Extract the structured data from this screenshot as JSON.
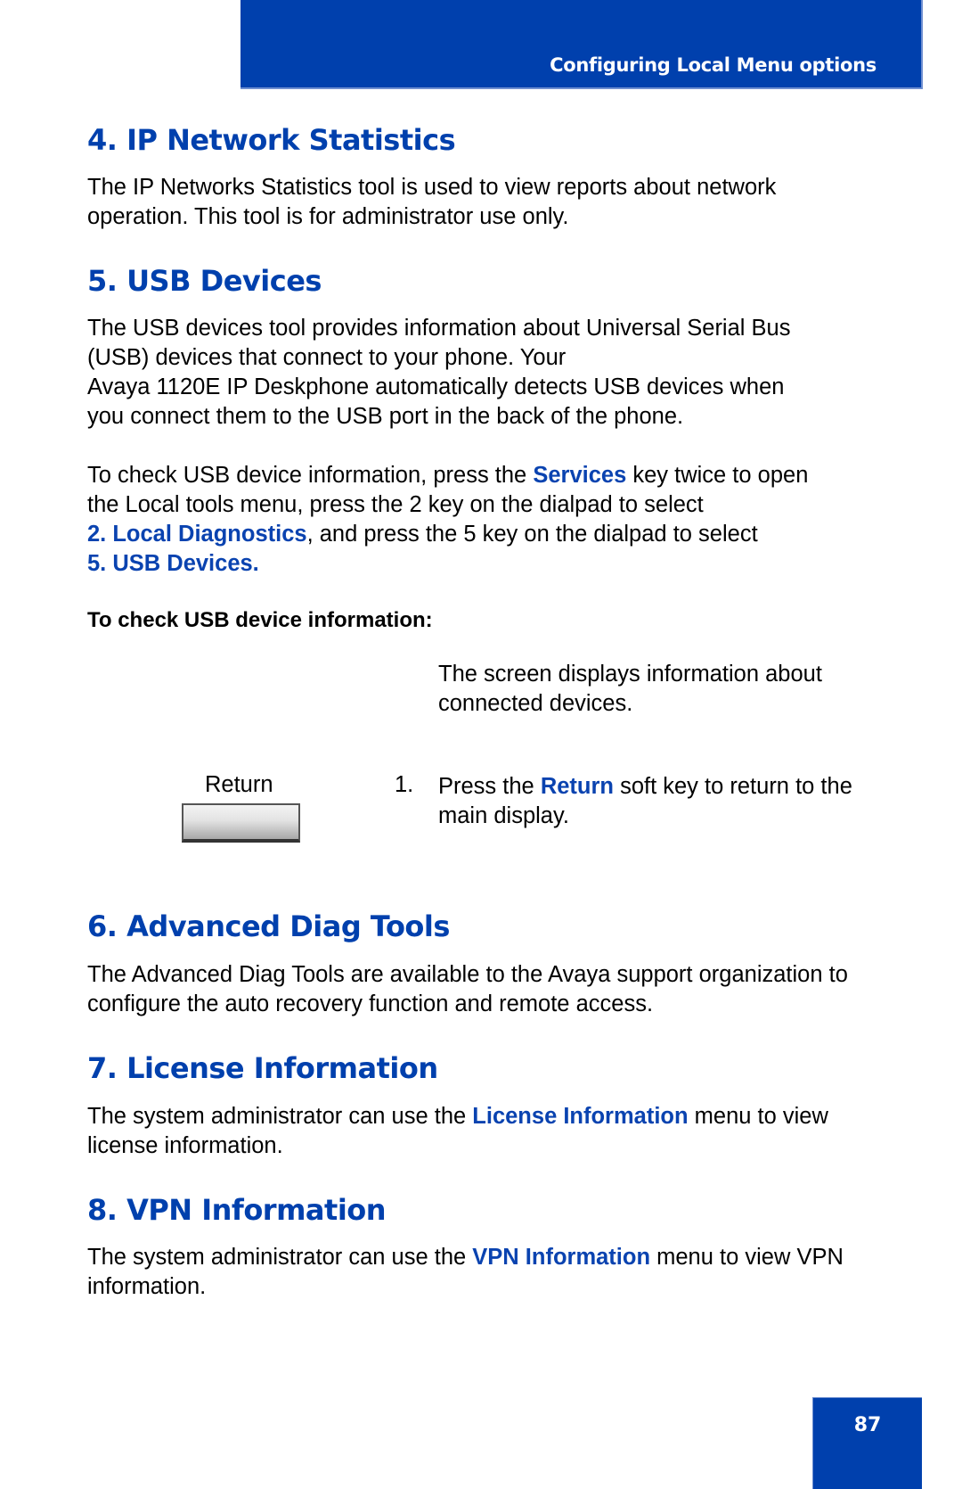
{
  "header": {
    "title": "Configuring Local Menu options"
  },
  "sections": [
    {
      "heading": "4. IP Network Statistics",
      "body": "The IP Networks Statistics tool is used to view reports about network operation. This tool is for administrator use only."
    },
    {
      "heading": "5. USB Devices",
      "body_lines": [
        "The USB devices tool provides information about Universal Serial Bus",
        "(USB) devices that connect to your phone. Your",
        "Avaya 1120E IP Deskphone automatically detects USB devices when",
        "you connect them to the USB port in the back of the phone."
      ],
      "instructions": {
        "p1": "To check USB device information, press the ",
        "services": "Services",
        "p2": " key twice to open",
        "p3": "the Local tools menu, press the 2 key on the dialpad to select",
        "local_diag": "2. Local Diagnostics",
        "p4": ", and press the 5 key on the dialpad to select",
        "usb_devices": "5. USB Devices."
      },
      "procedure_heading": "To check USB device information:",
      "screen_text": "The screen displays information about connected devices.",
      "softkey_label": "Return",
      "step": {
        "number": "1.",
        "t1": "Press the ",
        "key": "Return",
        "t2": " soft key to return to the main display."
      }
    },
    {
      "heading": "6. Advanced Diag Tools",
      "body": "The Advanced Diag Tools are available to the Avaya support organization to configure the auto recovery function and remote access."
    },
    {
      "heading": "7. License Information",
      "t1": "The system administrator can use the ",
      "key": "License Information",
      "t2": " menu to view license information."
    },
    {
      "heading": "8. VPN Information",
      "t1": "The system administrator can use the ",
      "key": "VPN Information",
      "t2": " menu to view VPN information."
    }
  ],
  "footer": {
    "page_number": "87"
  },
  "colors": {
    "brand_blue": "#0040ad",
    "link_blue": "#0a43b0"
  }
}
